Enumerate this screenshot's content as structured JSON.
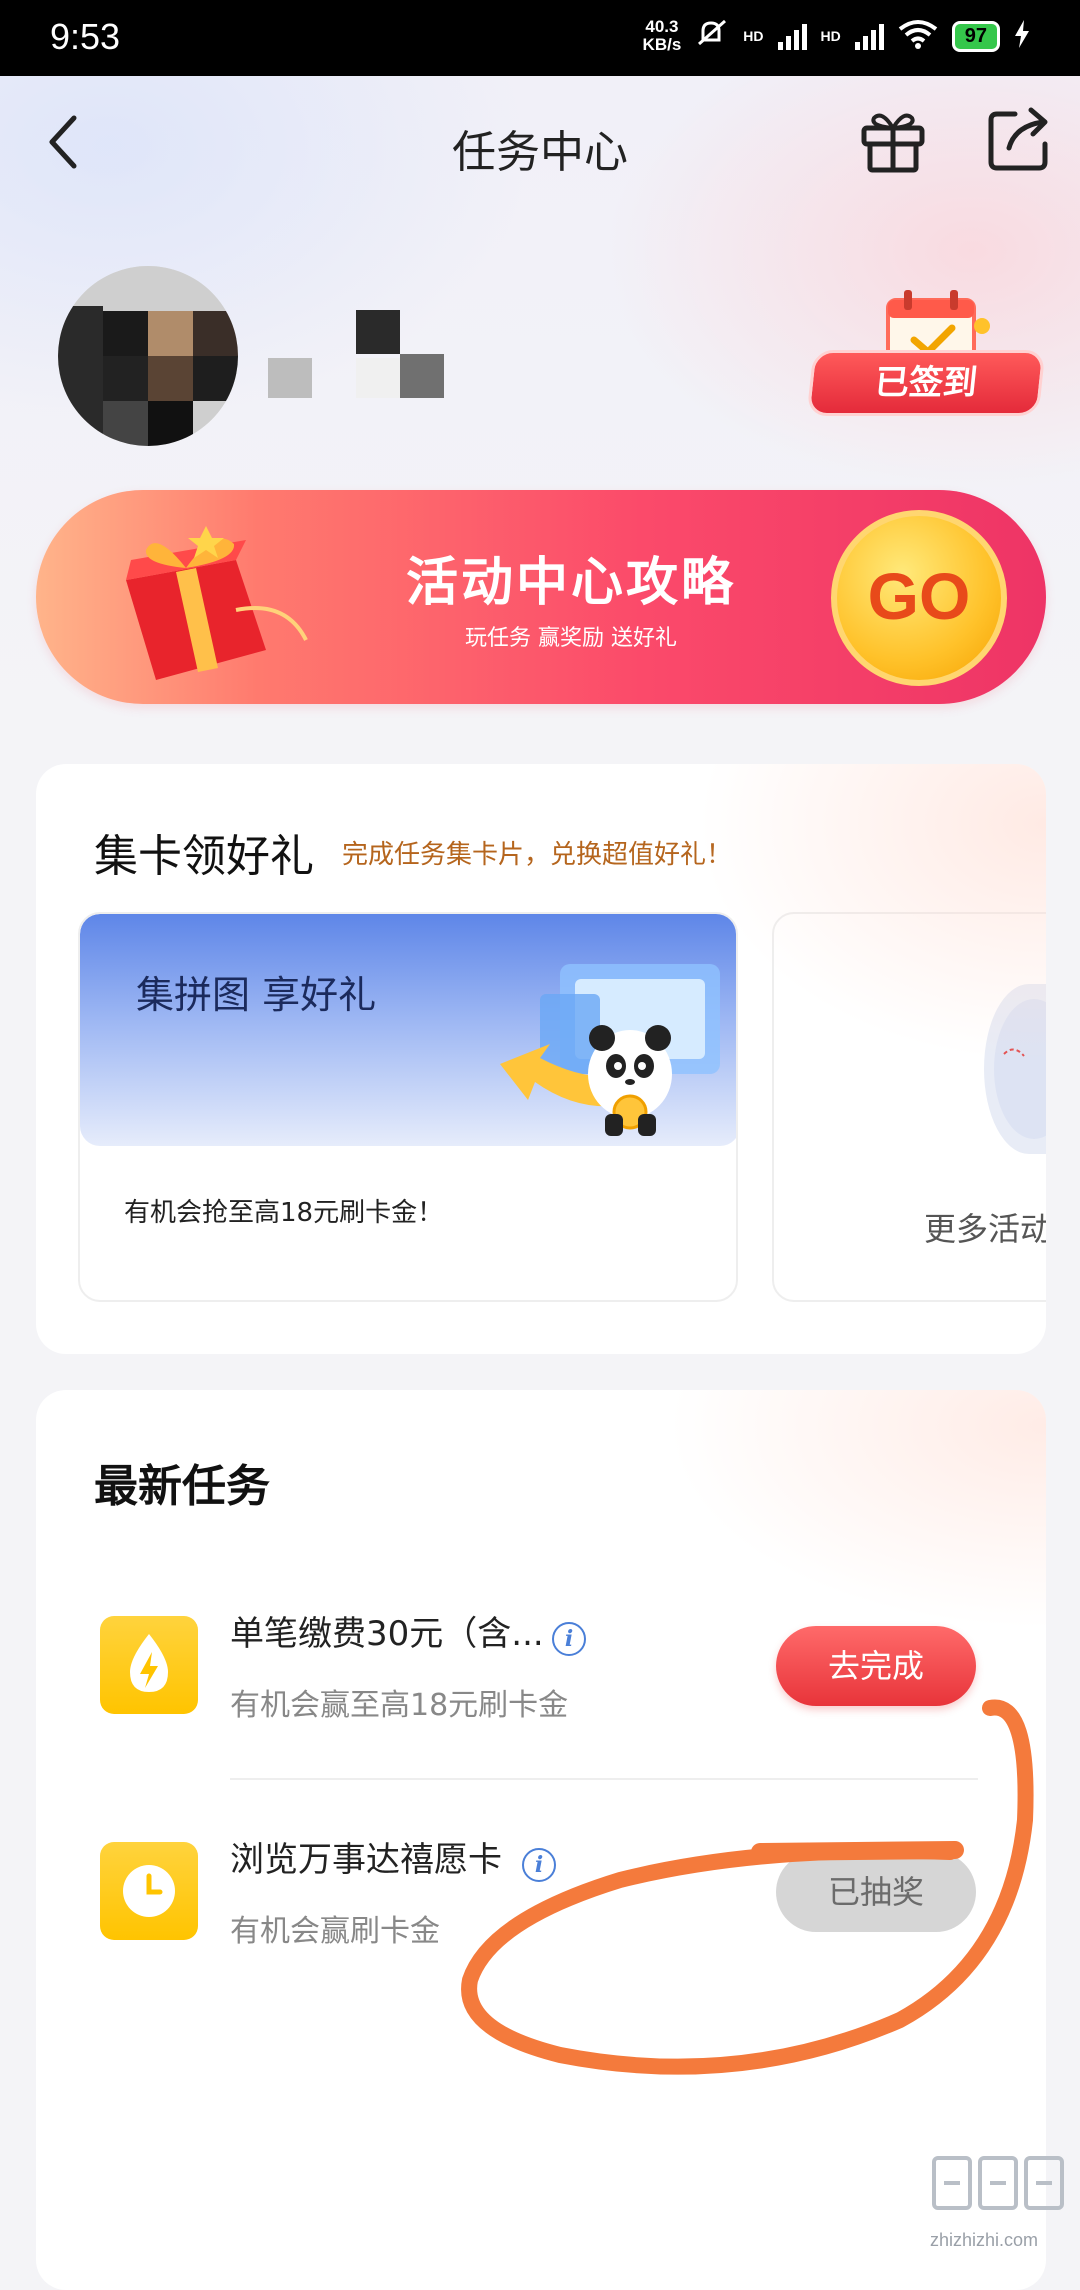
{
  "status_bar": {
    "time": "9:53",
    "net_speed_value": "40.3",
    "net_speed_unit": "KB/s",
    "hd1": "HD",
    "hd2": "HD",
    "battery": "97"
  },
  "nav": {
    "title": "任务中心",
    "icons": [
      "back-icon",
      "gift-icon",
      "share-icon"
    ]
  },
  "profile": {
    "checkin_label": "已签到"
  },
  "banner": {
    "title": "活动中心攻略",
    "subtitle": "玩任务 赢奖励 送好礼",
    "go_label": "GO"
  },
  "cards_section": {
    "title": "集卡领好礼",
    "subtitle": "完成任务集卡片，兑换超值好礼！",
    "tile1": {
      "image_title": "集拼图 享好礼",
      "desc": "有机会抢至高18元刷卡金！"
    },
    "tile2": {
      "label": "更多活动"
    }
  },
  "tasks_section": {
    "title": "最新任务",
    "tasks": [
      {
        "title": "单笔缴费30元（含...",
        "sub": "有机会赢至高18元刷卡金",
        "button": "去完成",
        "icon": "drop-bolt-icon"
      },
      {
        "title": "浏览万事达禧愿卡",
        "sub": "有机会赢刷卡金",
        "button": "已抽奖",
        "icon": "clock-icon"
      }
    ]
  },
  "watermark": {
    "text": "zhizhizhi.com"
  },
  "colors": {
    "accent_red": "#e8343a",
    "banner_gradient_end": "#ee3466",
    "gold": "#ffc22a",
    "annotation_orange": "#f47a3c",
    "task_icon_yellow": "#ffc400"
  }
}
